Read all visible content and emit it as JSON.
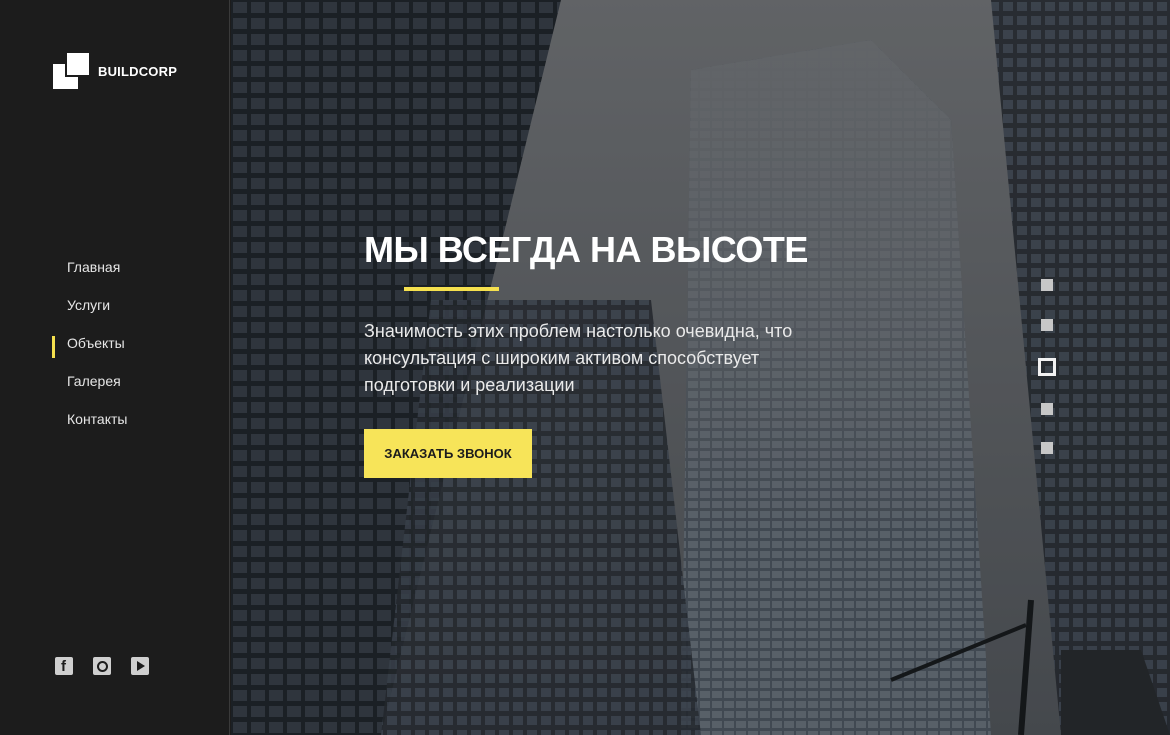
{
  "brand": {
    "name": "BUILDCORP"
  },
  "nav": {
    "items": [
      {
        "label": "Главная"
      },
      {
        "label": "Услуги"
      },
      {
        "label": "Объекты",
        "active": true
      },
      {
        "label": "Галерея"
      },
      {
        "label": "Контакты"
      }
    ]
  },
  "social": [
    "facebook-icon",
    "instagram-icon",
    "youtube-icon"
  ],
  "hero": {
    "title": "МЫ ВСЕГДА НА ВЫСОТЕ",
    "description": "Значимость этих проблем настолько очевидна, что консультация с широким активом способствует подготовки и реализации",
    "button_label": "ЗАКАЗАТЬ ЗВОНОК"
  },
  "slider": {
    "total": 5,
    "active_index": 3
  },
  "colors": {
    "accent": "#f5e04e",
    "sidebar": "#1c1c1c",
    "text": "#ffffff"
  }
}
